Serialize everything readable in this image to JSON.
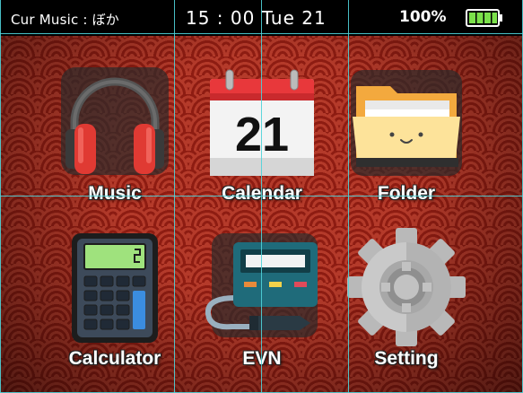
{
  "status_bar": {
    "current_music": "Cur Music : ぼか",
    "clock": "15 : 00 Tue 21",
    "battery_percent_text": "100%",
    "battery_level": 1.0
  },
  "apps": [
    {
      "label": "Music",
      "icon": "headphones-icon"
    },
    {
      "label": "Calendar",
      "icon": "calendar-icon",
      "calendar_day": "21"
    },
    {
      "label": "Folder",
      "icon": "folder-icon"
    },
    {
      "label": "Calculator",
      "icon": "calculator-icon"
    },
    {
      "label": "EVN",
      "icon": "evn-device-icon"
    },
    {
      "label": "Setting",
      "icon": "gear-icon"
    }
  ],
  "colors": {
    "background": "#8e1c12",
    "wave_pattern": "#b43a2a",
    "guide_lines": "#4fd3d9",
    "battery_fill": "#7be04a"
  }
}
